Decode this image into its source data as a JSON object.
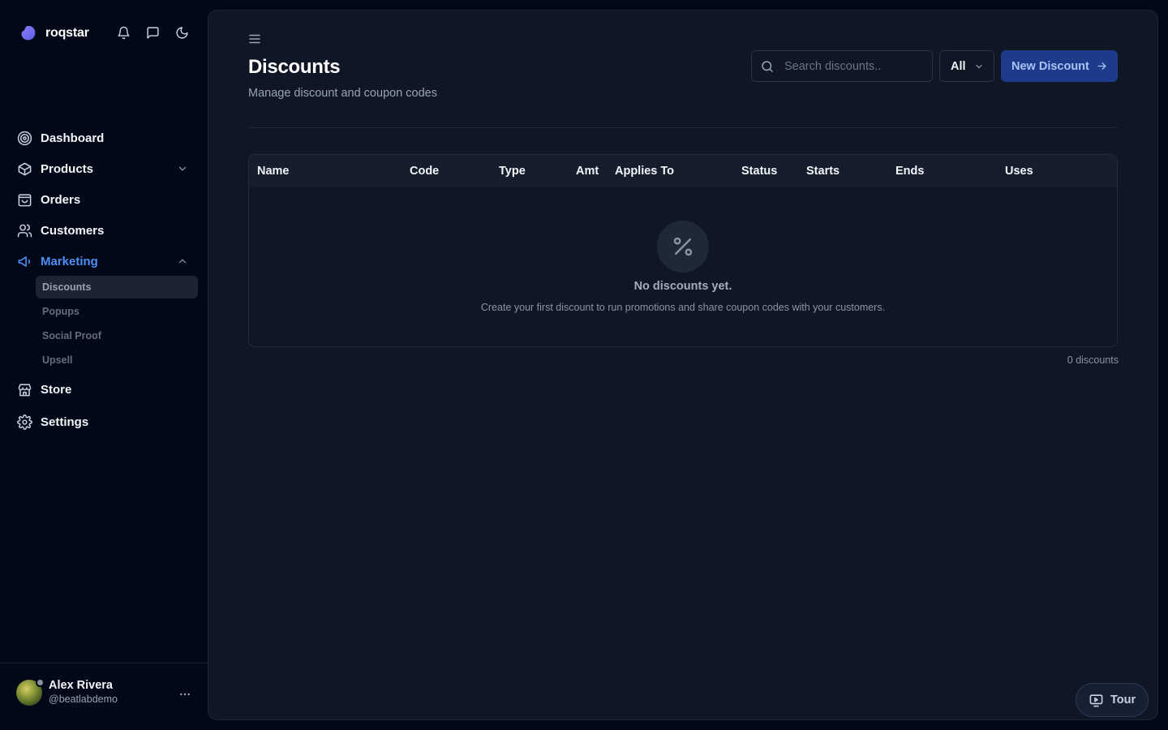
{
  "app": {
    "name": "roqstar"
  },
  "sidebar": {
    "items": [
      {
        "label": "Dashboard",
        "icon": "target-icon"
      },
      {
        "label": "Products",
        "icon": "box-icon"
      },
      {
        "label": "Orders",
        "icon": "shopping-bag-icon"
      },
      {
        "label": "Customers",
        "icon": "users-icon"
      },
      {
        "label": "Marketing",
        "icon": "megaphone-icon",
        "active": true,
        "children": [
          {
            "label": "Discounts",
            "active": true
          },
          {
            "label": "Popups"
          },
          {
            "label": "Social Proof"
          },
          {
            "label": "Upsell"
          }
        ]
      },
      {
        "label": "Store",
        "icon": "store-icon"
      },
      {
        "label": "Settings",
        "icon": "gear-icon"
      }
    ]
  },
  "user": {
    "name": "Alex Rivera",
    "handle": "@beatlabdemo"
  },
  "page": {
    "title": "Discounts",
    "subtitle": "Manage discount and coupon codes",
    "search_placeholder": "Search discounts..",
    "filter_value": "All",
    "new_button": "New Discount"
  },
  "table": {
    "columns": [
      "Name",
      "Code",
      "Type",
      "Amt",
      "Applies To",
      "Status",
      "Starts",
      "Ends",
      "Uses"
    ],
    "rows": [],
    "empty_title": "No discounts yet.",
    "empty_description": "Create your first discount to run promotions and share coupon codes with your customers."
  },
  "count_label": "0 discounts",
  "tour_label": "Tour",
  "colors": {
    "background": "#020817",
    "panel": "#0f1727",
    "accent": "#4f8ef7",
    "primary_button": "#1e3a8a"
  }
}
